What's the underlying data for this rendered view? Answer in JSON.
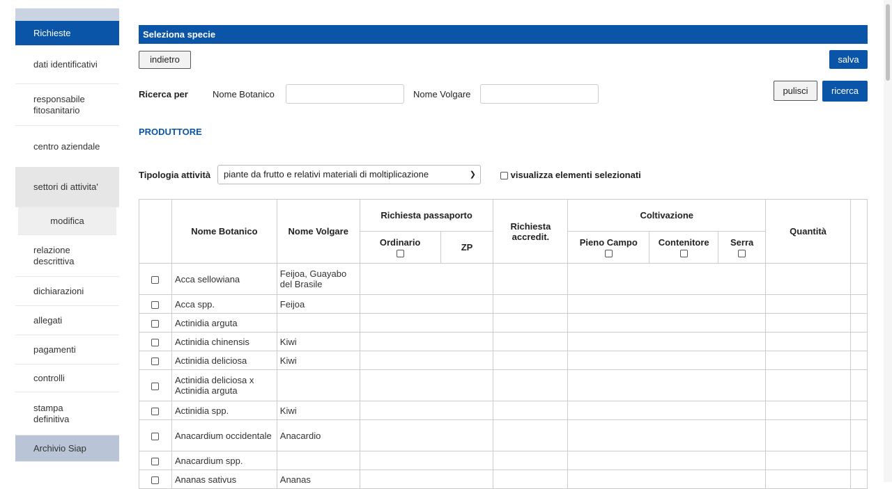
{
  "sidebar": {
    "items": [
      {
        "label": "Richieste"
      },
      {
        "label": "dati identificativi"
      },
      {
        "label": "responsabile fitosanitario"
      },
      {
        "label": "centro aziendale"
      },
      {
        "label": "settori di attivita'"
      },
      {
        "label": "modifica"
      },
      {
        "label": "relazione descrittiva"
      },
      {
        "label": "dichiarazioni"
      },
      {
        "label": "allegati"
      },
      {
        "label": "pagamenti"
      },
      {
        "label": "controlli"
      },
      {
        "label": "stampa definitiva"
      },
      {
        "label": "Archivio Siap"
      }
    ]
  },
  "main": {
    "title": "Seleziona specie",
    "back_label": "indietro",
    "save_label": "salva",
    "search": {
      "label": "Ricerca per",
      "botanico_label": "Nome Botanico",
      "volgare_label": "Nome Volgare",
      "botanico_value": "",
      "volgare_value": "",
      "clear_label": "pulisci",
      "search_label": "ricerca"
    },
    "produttore_label": "PRODUTTORE",
    "tipologia_label": "Tipologia attività",
    "tipologia_selected": "piante da frutto e relativi materiali di moltiplicazione",
    "show_selected_label": "visualizza elementi selezionati"
  },
  "table": {
    "headers": {
      "nome_botanico": "Nome Botanico",
      "nome_volgare": "Nome Volgare",
      "richiesta_passaporto": "Richiesta passaporto",
      "ordinario": "Ordinario",
      "zp": "ZP",
      "richiesta_accredit": "Richiesta accredit.",
      "coltivazione": "Coltivazione",
      "pieno_campo": "Pieno Campo",
      "contenitore": "Contenitore",
      "serra": "Serra",
      "quantita": "Quantità"
    },
    "rows": [
      {
        "botanico": "Acca sellowiana",
        "volgare": "Feijoa, Guayabo del Brasile"
      },
      {
        "botanico": "Acca spp.",
        "volgare": "Feijoa"
      },
      {
        "botanico": "Actinidia arguta",
        "volgare": ""
      },
      {
        "botanico": "Actinidia chinensis",
        "volgare": "Kiwi"
      },
      {
        "botanico": "Actinidia deliciosa",
        "volgare": "Kiwi"
      },
      {
        "botanico": "Actinidia deliciosa x Actinidia arguta",
        "volgare": ""
      },
      {
        "botanico": "Actinidia spp.",
        "volgare": "Kiwi"
      },
      {
        "botanico": "Anacardium occidentale",
        "volgare": "Anacardio"
      },
      {
        "botanico": "Anacardium spp.",
        "volgare": ""
      },
      {
        "botanico": "Ananas sativus",
        "volgare": "Ananas"
      }
    ]
  },
  "colors": {
    "primary": "#0b55a8",
    "sidebar_grey": "#e6e6e6",
    "sidebar_archivio": "#b9c5d6"
  }
}
